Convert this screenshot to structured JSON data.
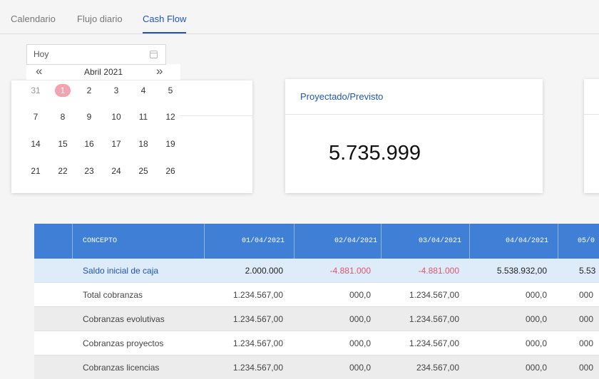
{
  "tabs": [
    {
      "label": "Calendario",
      "active": false
    },
    {
      "label": "Flujo diario",
      "active": false
    },
    {
      "label": "Cash Flow",
      "active": true
    }
  ],
  "date_picker": {
    "input_value": "Hoy",
    "month_label": "Abril 2021",
    "prev_icon": "«",
    "next_icon": "»",
    "weeks": [
      [
        "31",
        "1",
        "2",
        "3",
        "4",
        "5"
      ],
      [
        "7",
        "8",
        "9",
        "10",
        "11",
        "12"
      ],
      [
        "14",
        "15",
        "16",
        "17",
        "18",
        "19"
      ],
      [
        "21",
        "22",
        "23",
        "24",
        "25",
        "26"
      ]
    ],
    "selected_day": "1"
  },
  "projected_card": {
    "title": "Proyectado/Previsto",
    "value": "5.735.999"
  },
  "table": {
    "header": {
      "concept": "CONCEPTO",
      "dates": [
        "01/04/2021",
        "02/04/2021",
        "03/04/2021",
        "04/04/2021",
        "05/0"
      ]
    },
    "rows": [
      {
        "label": "Saldo inicial de caja",
        "values": [
          "2.000.000",
          "-4.881.000",
          "-4.881.000",
          "5.538.932,00",
          "5.53"
        ]
      },
      {
        "label": "Total cobranzas",
        "values": [
          "1.234.567,00",
          "000,0",
          "1.234.567,00",
          "000,0",
          "000"
        ]
      },
      {
        "label": "Cobranzas evolutivas",
        "values": [
          "1.234.567,00",
          "000,0",
          "1.234.567,00",
          "000,0",
          "000"
        ]
      },
      {
        "label": "Cobranzas proyectos",
        "values": [
          "1.234.567,00",
          "000,0",
          "1.234.567,00",
          "000,0",
          "000"
        ]
      },
      {
        "label": "Cobranzas licencias",
        "values": [
          "1.234.567,00",
          "000,0",
          "234.567,00",
          "000,0",
          "000"
        ]
      }
    ]
  },
  "colors": {
    "accent": "#1f55b8",
    "header_bg": "#3f7fd5",
    "negative": "#e0566a",
    "highlight_row": "#deebf9",
    "alt_row": "#ececed",
    "selected_day": "#f3a3ad"
  }
}
